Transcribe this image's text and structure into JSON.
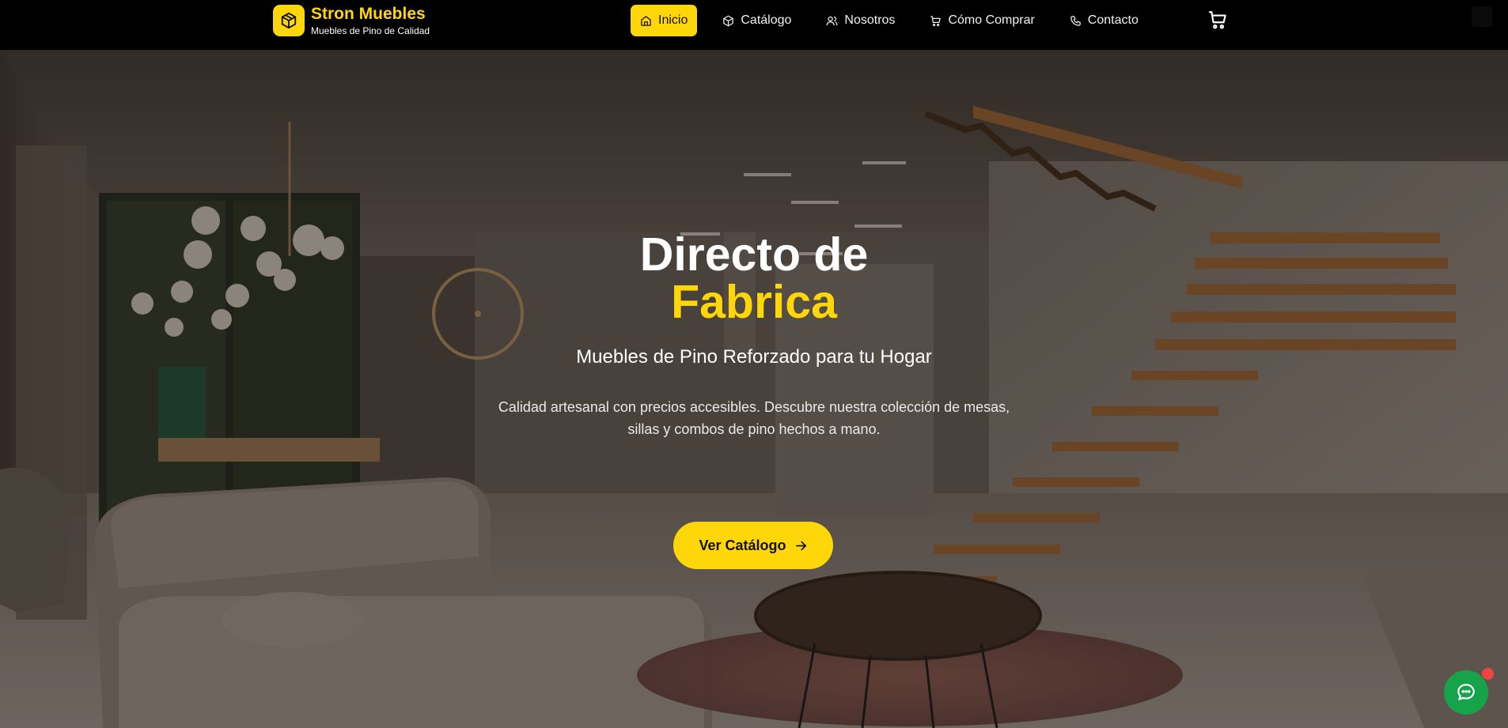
{
  "brand": {
    "name": "Stron Muebles",
    "tagline": "Muebles de Pino de Calidad",
    "logo_icon": "box-icon"
  },
  "nav": {
    "items": [
      {
        "label": "Inicio",
        "icon": "home-icon",
        "active": true
      },
      {
        "label": "Catálogo",
        "icon": "box-icon",
        "active": false
      },
      {
        "label": "Nosotros",
        "icon": "users-icon",
        "active": false
      },
      {
        "label": "Cómo Comprar",
        "icon": "cart-icon",
        "active": false
      },
      {
        "label": "Contacto",
        "icon": "phone-icon",
        "active": false
      }
    ],
    "cart_icon": "cart-icon"
  },
  "hero": {
    "title_line1": "Directo de",
    "title_line2": "Fabrica",
    "subtitle": "Muebles de Pino Reforzado para tu Hogar",
    "description": "Calidad artesanal con precios accesibles. Descubre nuestra colección de mesas, sillas y combos de pino hechos a mano.",
    "cta_label": "Ver Catálogo",
    "cta_icon": "arrow-right-icon"
  },
  "chat": {
    "icon": "chat-icon",
    "notification": true
  },
  "colors": {
    "accent": "#ffd60a",
    "nav_bg": "#000000",
    "chat": "#16a34a",
    "notification": "#ef4444"
  }
}
